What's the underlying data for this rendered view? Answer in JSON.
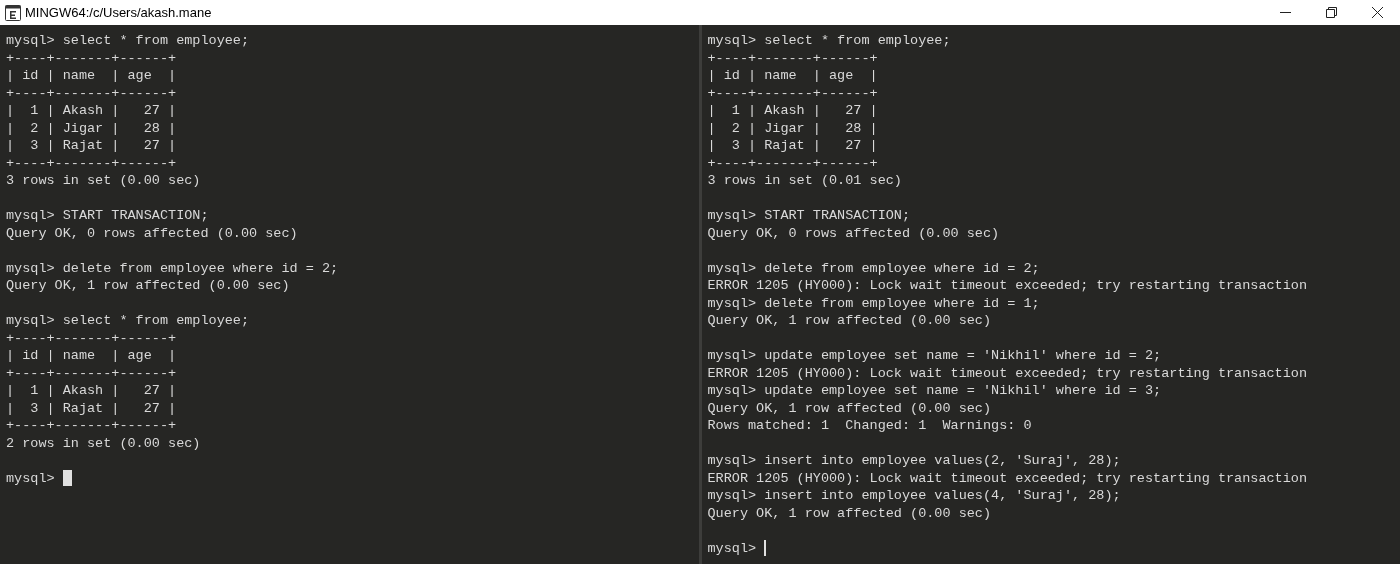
{
  "window": {
    "title": "MINGW64:/c/Users/akash.mane"
  },
  "panes": [
    {
      "blocks": [
        [
          "mysql> select * from employee;",
          "+----+-------+------+",
          "| id | name  | age  |",
          "+----+-------+------+",
          "|  1 | Akash |   27 |",
          "|  2 | Jigar |   28 |",
          "|  3 | Rajat |   27 |",
          "+----+-------+------+",
          "3 rows in set (0.00 sec)"
        ],
        [
          "mysql> START TRANSACTION;",
          "Query OK, 0 rows affected (0.00 sec)"
        ],
        [
          "mysql> delete from employee where id = 2;",
          "Query OK, 1 row affected (0.00 sec)"
        ],
        [
          "mysql> select * from employee;",
          "+----+-------+------+",
          "| id | name  | age  |",
          "+----+-------+------+",
          "|  1 | Akash |   27 |",
          "|  3 | Rajat |   27 |",
          "+----+-------+------+",
          "2 rows in set (0.00 sec)"
        ]
      ],
      "prompt": "mysql>",
      "cursor": {
        "kind": "block"
      }
    },
    {
      "blocks": [
        [
          "mysql> select * from employee;",
          "+----+-------+------+",
          "| id | name  | age  |",
          "+----+-------+------+",
          "|  1 | Akash |   27 |",
          "|  2 | Jigar |   28 |",
          "|  3 | Rajat |   27 |",
          "+----+-------+------+",
          "3 rows in set (0.01 sec)"
        ],
        [
          "mysql> START TRANSACTION;",
          "Query OK, 0 rows affected (0.00 sec)"
        ],
        [
          "mysql> delete from employee where id = 2;",
          "ERROR 1205 (HY000): Lock wait timeout exceeded; try restarting transaction",
          "mysql> delete from employee where id = 1;",
          "Query OK, 1 row affected (0.00 sec)"
        ],
        [
          "mysql> update employee set name = 'Nikhil' where id = 2;",
          "ERROR 1205 (HY000): Lock wait timeout exceeded; try restarting transaction",
          "mysql> update employee set name = 'Nikhil' where id = 3;",
          "Query OK, 1 row affected (0.00 sec)",
          "Rows matched: 1  Changed: 1  Warnings: 0"
        ],
        [
          "mysql> insert into employee values(2, 'Suraj', 28);",
          "ERROR 1205 (HY000): Lock wait timeout exceeded; try restarting transaction",
          "mysql> insert into employee values(4, 'Suraj', 28);",
          "Query OK, 1 row affected (0.00 sec)"
        ]
      ],
      "prompt": "mysql>",
      "cursor": {
        "kind": "bar"
      }
    }
  ]
}
